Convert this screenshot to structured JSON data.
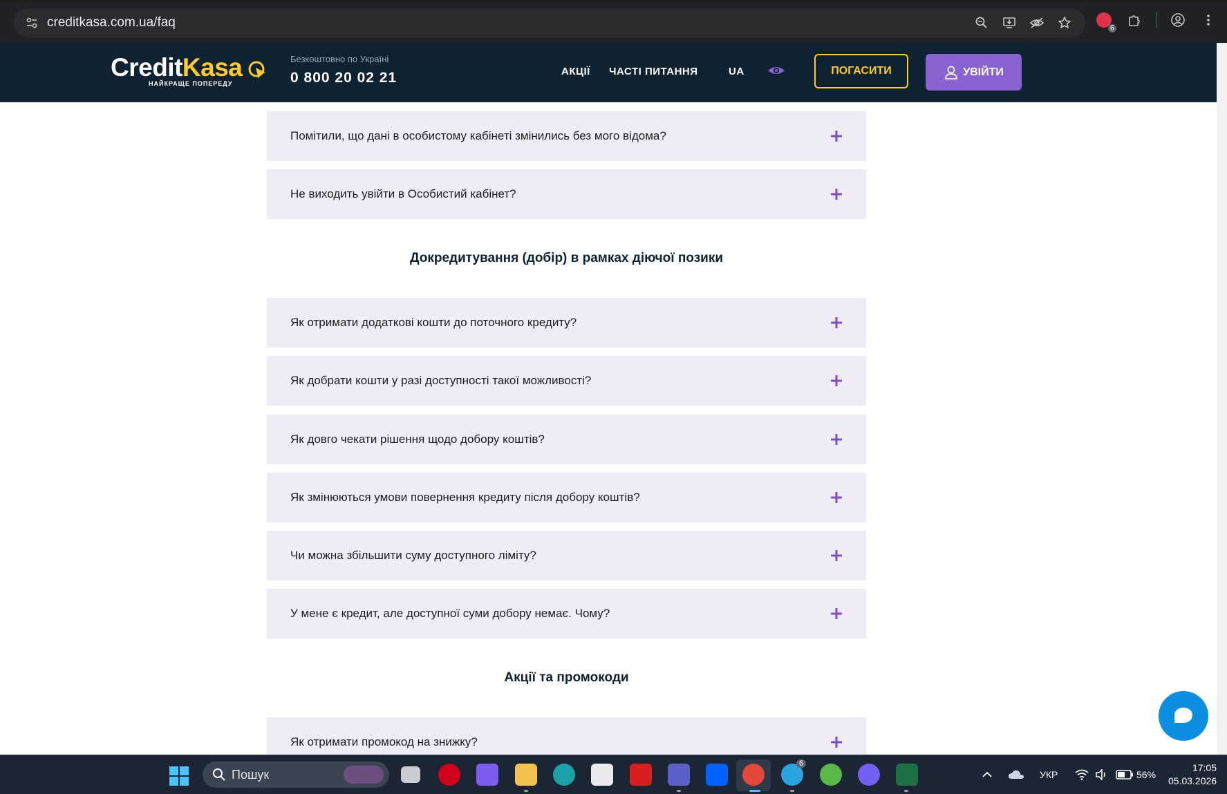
{
  "browser": {
    "url": "creditkasa.com.ua/faq",
    "extension_badge": "6"
  },
  "header": {
    "logo_credit": "Credit",
    "logo_kasa": "Kasa",
    "logo_tagline": "НАЙКРАЩЕ ПОПЕРЕДУ",
    "phone_note": "Безкоштовно по Україні",
    "phone": "0 800 20 02 21",
    "nav": {
      "promos": "АКЦІЇ",
      "faq": "ЧАСТІ ПИТАННЯ",
      "lang": "UA"
    },
    "pay_button": "ПОГАСИТИ",
    "login_button": "УВІЙТИ",
    "accent_yellow": "#ffcc29",
    "accent_purple": "#8a63d2",
    "header_bg": "#0f2231"
  },
  "faq": {
    "group1": [
      "Помітили, що дані в особистому кабінеті змінились без мого відома?",
      "Не виходить увійти в Особистий кабінет?"
    ],
    "section2_title": "Докредитування (добір) в рамках діючої позики",
    "group2": [
      "Як отримати додаткові кошти до поточного кредиту?",
      "Як добрати кошти у разі доступності такої можливості?",
      "Як довго чекати рішення щодо добору коштів?",
      "Як змінюються умови повернення кредиту після добору коштів?",
      "Чи можна збільшити суму доступного ліміту?",
      "У мене є кредит, але доступної суми добору немає. Чому?"
    ],
    "section3_title": "Акції та промокоди",
    "group3": [
      "Як отримати промокод на знижку?"
    ]
  },
  "taskbar": {
    "search_placeholder": "Пошук",
    "telegram_badge": "6",
    "language": "УКР",
    "battery": "56%",
    "time": "17:05",
    "date": "05.03.2026"
  }
}
